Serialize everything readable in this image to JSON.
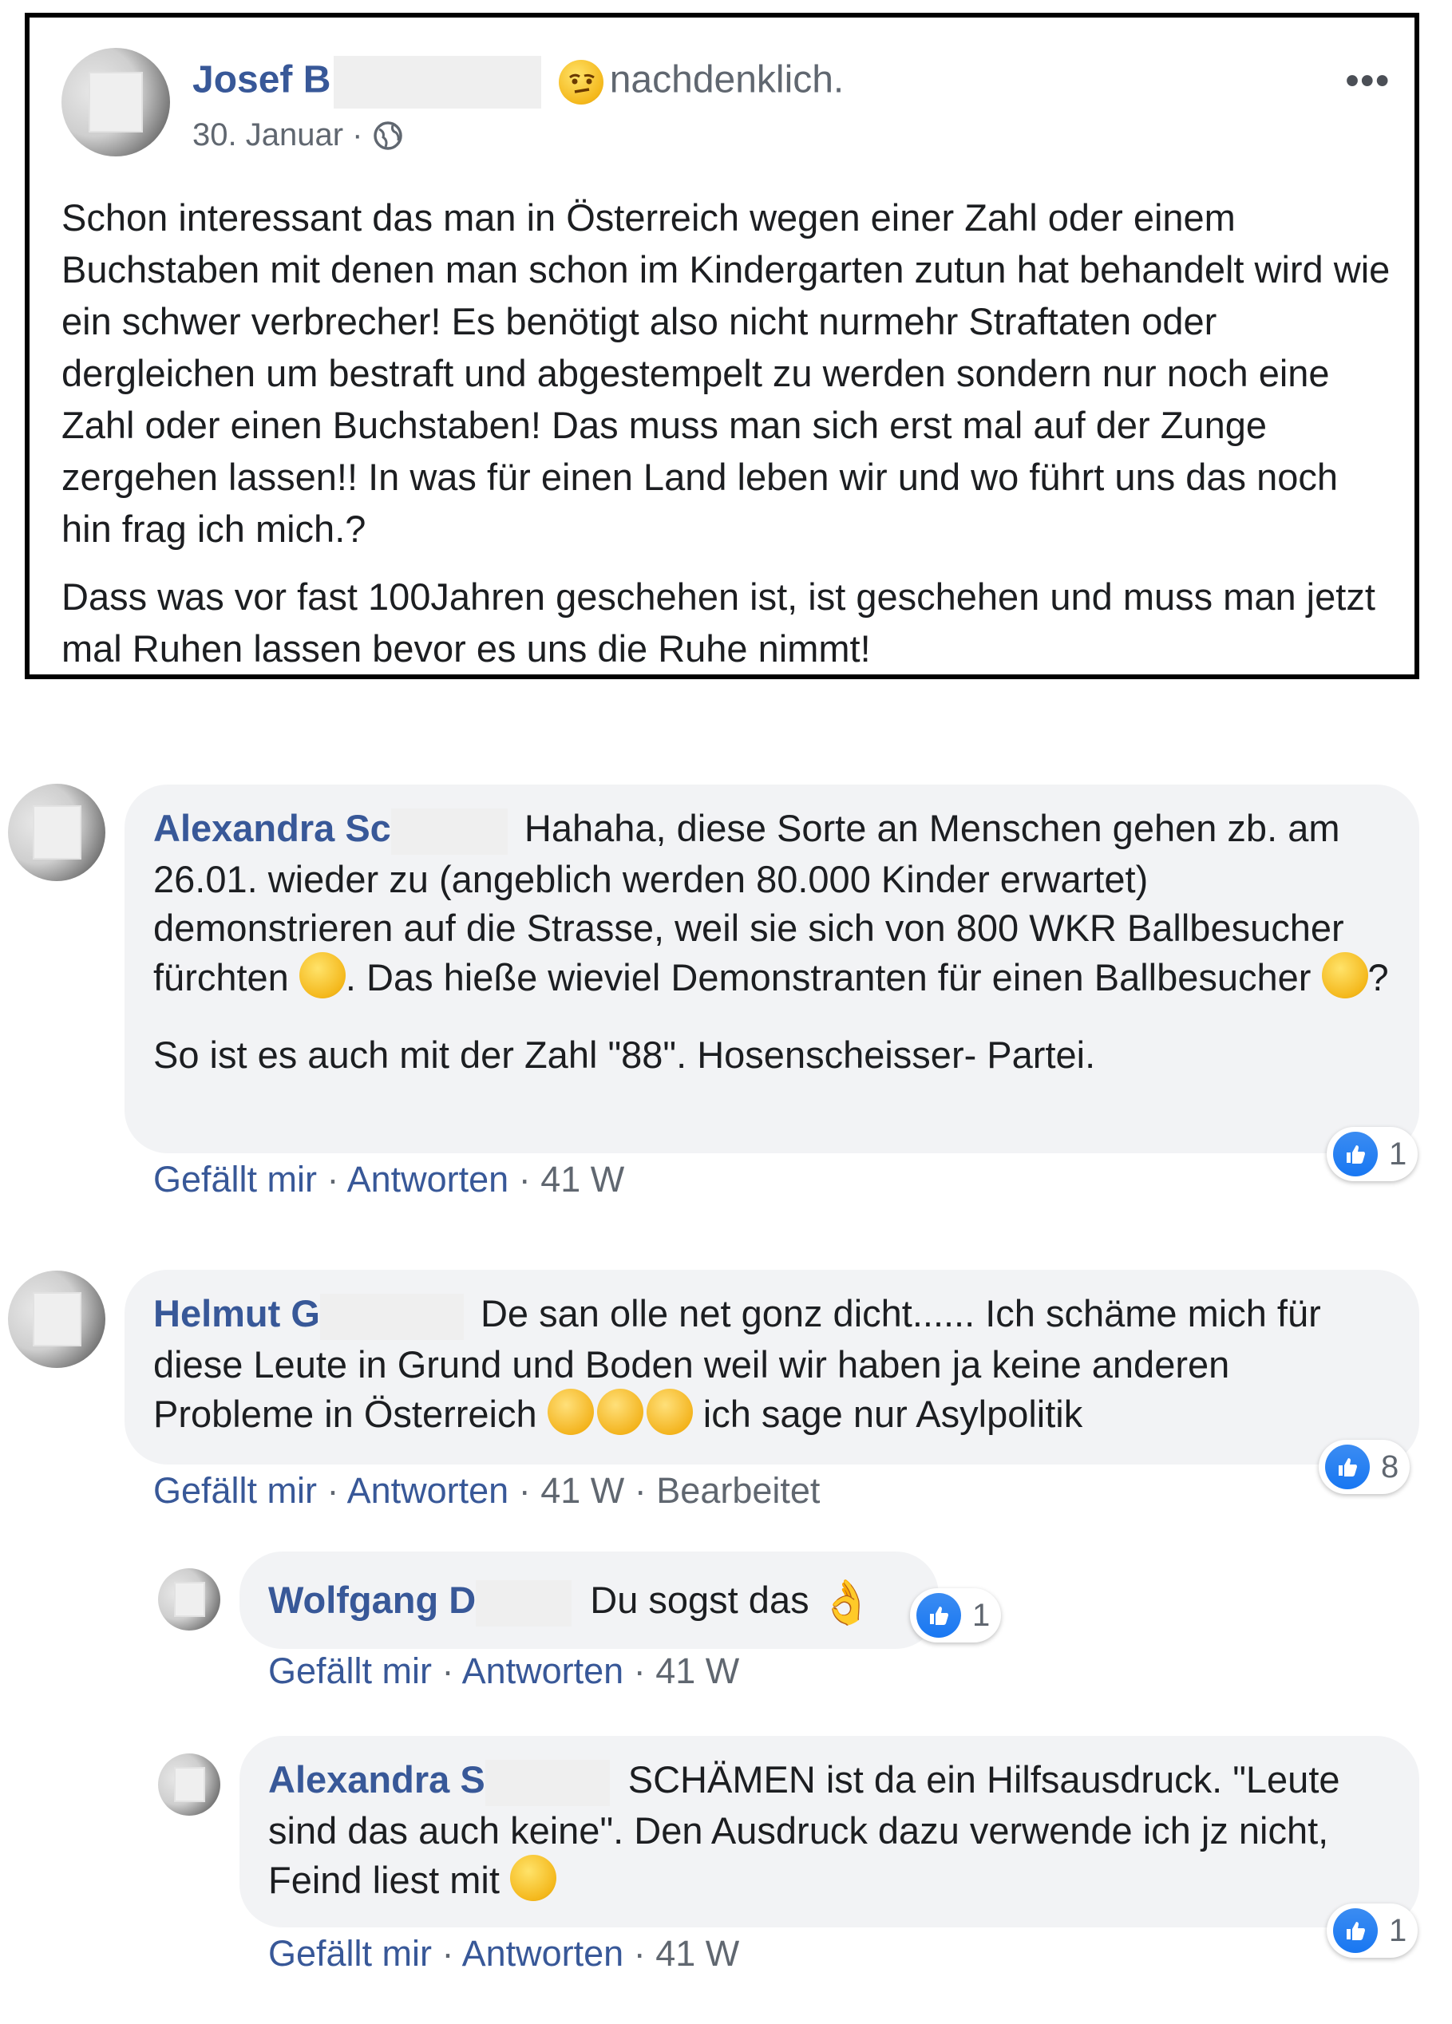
{
  "post": {
    "author": "Josef B",
    "feeling": "nachdenklich.",
    "date": "30. Januar",
    "separator": "·",
    "more": "•••",
    "paragraphs": [
      "Schon interessant das man in Österreich wegen einer Zahl oder einem Buchstaben mit denen man schon im Kindergarten zutun hat behandelt wird wie ein schwer verbrecher! Es benötigt also nicht nurmehr Straftaten oder dergleichen um bestraft und abgestempelt zu werden sondern nur noch eine Zahl oder einen Buchstaben! Das muss man sich erst mal auf der Zunge zergehen lassen!! In was für einen Land leben wir und wo führt uns das noch hin frag ich mich.?",
      "Dass was vor fast 100Jahren geschehen ist, ist geschehen und muss man jetzt mal Ruhen lassen bevor es uns die Ruhe nimmt!"
    ]
  },
  "comments": [
    {
      "author": "Alexandra Sc",
      "text_1": "Hahaha, diese Sorte an Menschen gehen zb. am 26.01. wieder zu (angeblich werden 80.000 Kinder erwartet) demonstrieren auf die Strasse, weil sie sich von 800 WKR Ballbesucher fürchten",
      "text_2": ". Das hieße wieviel Demonstranten für einen Ballbesucher",
      "text_3": "?",
      "text_4": "So ist es auch mit der Zahl \"88\". Hosenscheisser- Partei.",
      "like": "Gefällt mir",
      "reply": "Antworten",
      "time": "41 W",
      "reactions": "1"
    },
    {
      "author": "Helmut G",
      "text_1": "De san olle net gonz dicht...... Ich schäme mich für diese Leute in Grund und Boden weil wir haben ja keine anderen Probleme in Österreich",
      "text_2": "ich sage nur Asylpolitik",
      "like": "Gefällt mir",
      "reply": "Antworten",
      "time": "41 W",
      "edited": "Bearbeitet",
      "reactions": "8"
    }
  ],
  "replies": [
    {
      "author": "Wolfgang D",
      "text_1": "Du sogst das",
      "like": "Gefällt mir",
      "reply": "Antworten",
      "time": "41 W",
      "reactions": "1"
    },
    {
      "author": "Alexandra S",
      "text_1": "SCHÄMEN ist da ein Hilfsausdruck. \"Leute sind das auch keine\". Den Ausdruck dazu verwende ich jz nicht, Feind liest mit",
      "like": "Gefällt mir",
      "reply": "Antworten",
      "time": "41 W",
      "reactions": "1"
    }
  ],
  "icons": {
    "globe": "globe-icon",
    "like": "like-icon",
    "emoji_thinking": "thinking-face-icon",
    "emoji_laughing": "laughing-face-icon",
    "emoji_angry": "angry-face-icon",
    "emoji_ok": "ok-hand-icon"
  },
  "colors": {
    "link": "#385898",
    "meta": "#606770",
    "bubble": "#f2f3f5",
    "like": "#1877f2"
  }
}
